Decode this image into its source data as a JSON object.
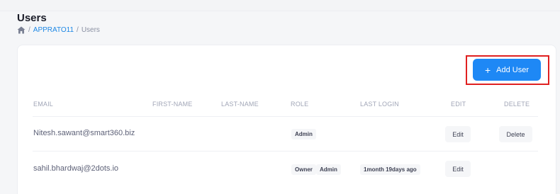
{
  "page": {
    "title": "Users",
    "breadcrumb": {
      "separator": "/",
      "link": "APPRATO11",
      "current": "Users"
    }
  },
  "toolbar": {
    "add_user_label": "Add User",
    "add_user_icon": "plus-icon"
  },
  "table": {
    "headers": [
      "EMAIL",
      "FIRST-NAME",
      "LAST-NAME",
      "ROLE",
      "LAST LOGIN",
      "EDIT",
      "DELETE"
    ],
    "rows": [
      {
        "email": "Nitesh.sawant@smart360.biz",
        "first_name": "",
        "last_name": "",
        "roles": [
          "Admin"
        ],
        "last_login": "",
        "edit_label": "Edit",
        "delete_label": "Delete"
      },
      {
        "email": "sahil.bhardwaj@2dots.io",
        "first_name": "",
        "last_name": "",
        "roles": [
          "Owner",
          "Admin"
        ],
        "last_login": "1month 19days ago",
        "edit_label": "Edit",
        "delete_label": ""
      }
    ]
  },
  "colors": {
    "accent": "#1e88f5",
    "highlight": "#e02020",
    "link": "#1e88e5"
  }
}
